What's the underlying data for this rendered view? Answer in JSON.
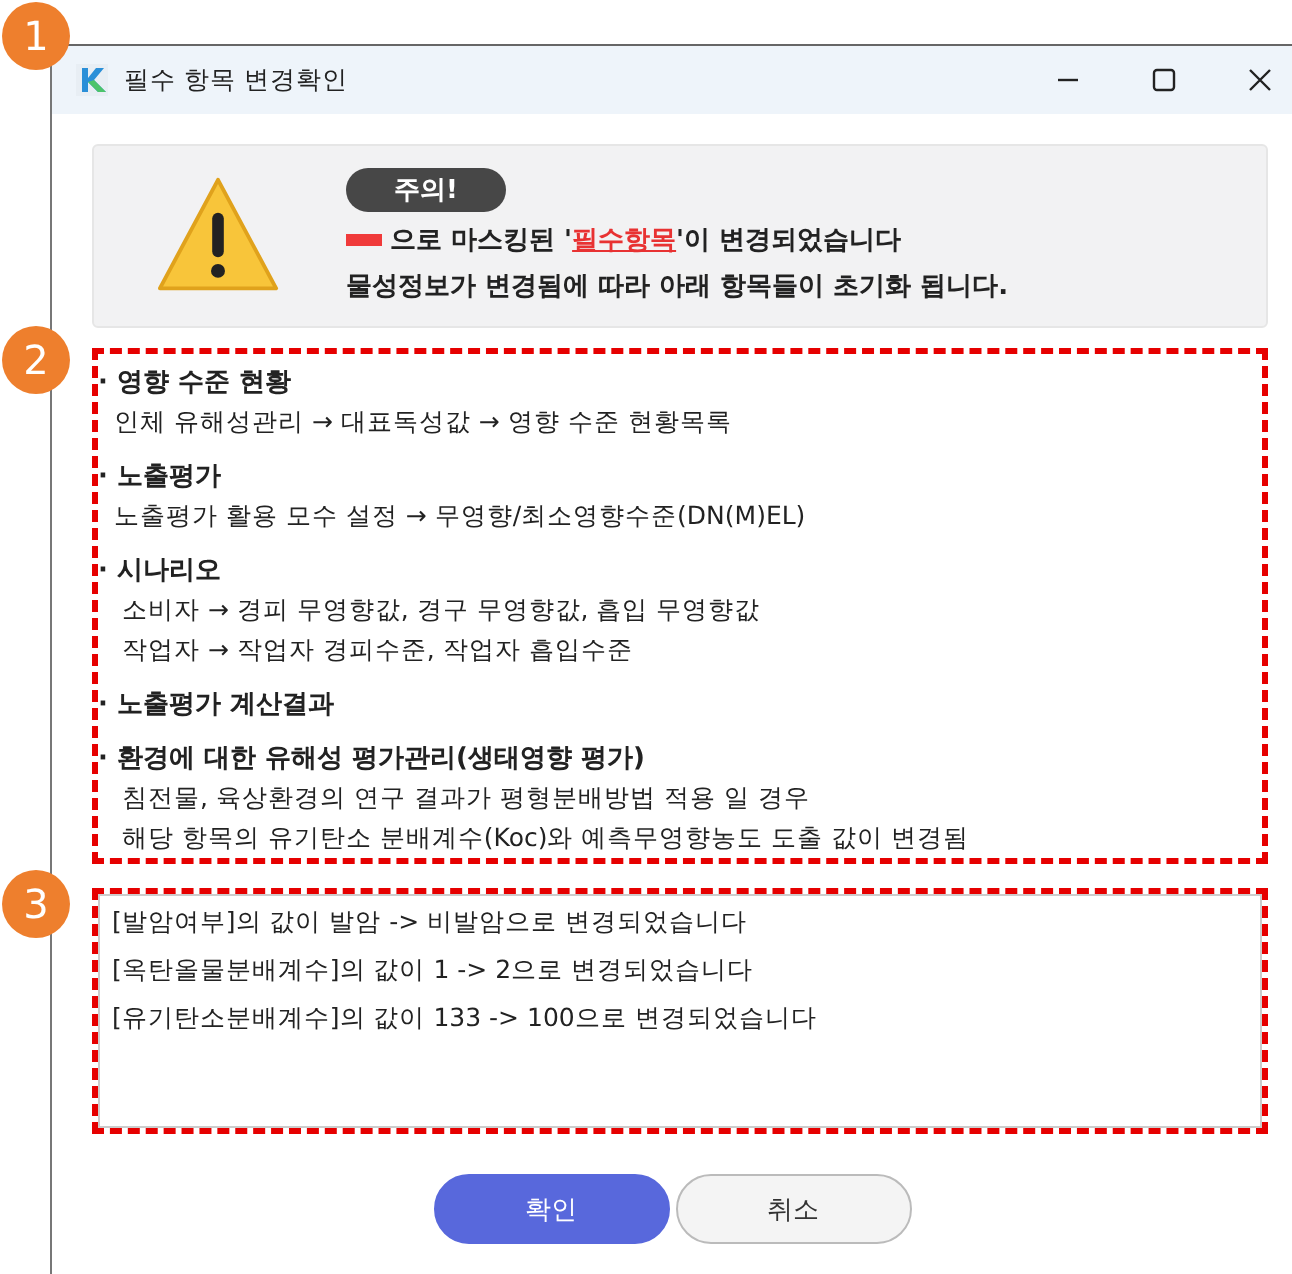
{
  "annotations": [
    {
      "number": "1"
    },
    {
      "number": "2"
    },
    {
      "number": "3"
    }
  ],
  "window": {
    "title": "필수 항목 변경확인"
  },
  "warning": {
    "badge": "주의!",
    "message_parts": [
      {
        "kind": "plain",
        "text": "으로 마스킹된 '"
      },
      {
        "kind": "masked",
        "text": "필수항목"
      },
      {
        "kind": "plain",
        "text": "'이 변경되었습니다"
      }
    ],
    "line2": "물성정보가 변경됨에 따라 아래 항목들이 초기화 됩니다."
  },
  "sections": [
    {
      "heading": "· 영향 수준 현황",
      "lines": [
        "인체 유해성관리 → 대표독성값 → 영향 수준 현황목록"
      ]
    },
    {
      "heading": "· 노출평가",
      "lines": [
        "노출평가 활용 모수 설정 → 무영향/최소영향수준(DN(M)EL)"
      ]
    },
    {
      "heading": "· 시나리오",
      "lines": [
        " 소비자 → 경피 무영향값, 경구 무영향값, 흡입 무영향값",
        " 작업자 → 작업자 경피수준, 작업자 흡입수준"
      ]
    },
    {
      "heading": "· 노출평가 계산결과"
    },
    {
      "heading": "· 환경에 대한 유해성 평가관리(생태영향 평가)",
      "lines": [
        " 침전물, 육상환경의 연구 결과가 평형분배방법 적용 일 경우",
        " 해당 항목의 유기탄소 분배계수(Koc)와 예측무영향농도 도출 값이 변경됨"
      ]
    }
  ],
  "changes": [
    "[발암여부]의 값이 발암 -> 비발암으로 변경되었습니다",
    "[옥탄올물분배계수]의 값이 1 -> 2으로 변경되었습니다",
    "[유기탄소분배계수]의 값이 133 -> 100으로 변경되었습니다"
  ],
  "buttons": [
    {
      "kind": "primary",
      "label": "확인"
    },
    {
      "kind": "secondary",
      "label": "취소"
    }
  ]
}
